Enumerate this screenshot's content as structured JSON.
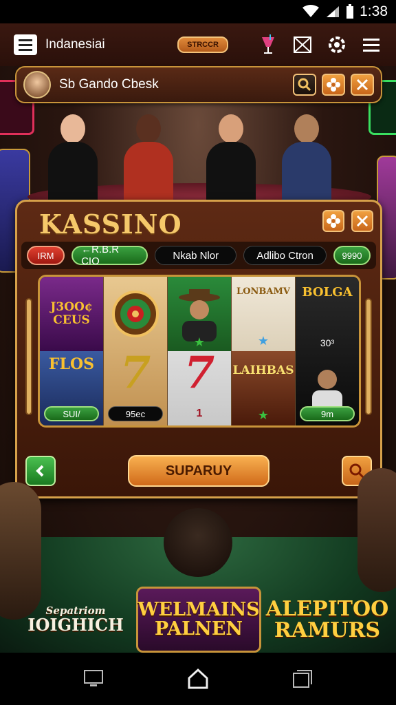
{
  "status_bar": {
    "time": "1:38",
    "icons": [
      "wifi-icon",
      "signal-icon",
      "battery-icon"
    ]
  },
  "app_bar": {
    "title": "Indanesiai",
    "pill_button": "STRCCR",
    "icons": [
      "drink-icon",
      "envelope-icon",
      "settings-icon",
      "hamburger-icon"
    ]
  },
  "search": {
    "text": "Sb Gando Cbesk"
  },
  "kassino": {
    "title": "KASSINO",
    "tabs": [
      "IRM",
      "←R.B.R CIO",
      "Nkab Nlor",
      "Adlibo Ctron",
      "9990"
    ],
    "reels": {
      "col1_top": "J3OO¢ CEUS",
      "col1_bottom": "FLOS",
      "col1_label": "SUI/",
      "col2_label": "95ec",
      "col3_value": "1",
      "col4_top": "LONBAMV",
      "col4_bottom": "LAIHBAS",
      "col5_top": "BOLGA",
      "col5_value": "30³",
      "col5_label": "9m"
    },
    "action_button": "SUPARUY"
  },
  "banners": {
    "left_top": "Sepatriom",
    "left_bottom": "IOIGHICH",
    "middle": "WELMAINS PALNEN",
    "right": "ALEPITOO RAMURS"
  },
  "colors": {
    "accent_gold": "#d6a14a",
    "panel_brown": "#5e2a14",
    "green": "#3aa040",
    "orange": "#f0a040"
  }
}
